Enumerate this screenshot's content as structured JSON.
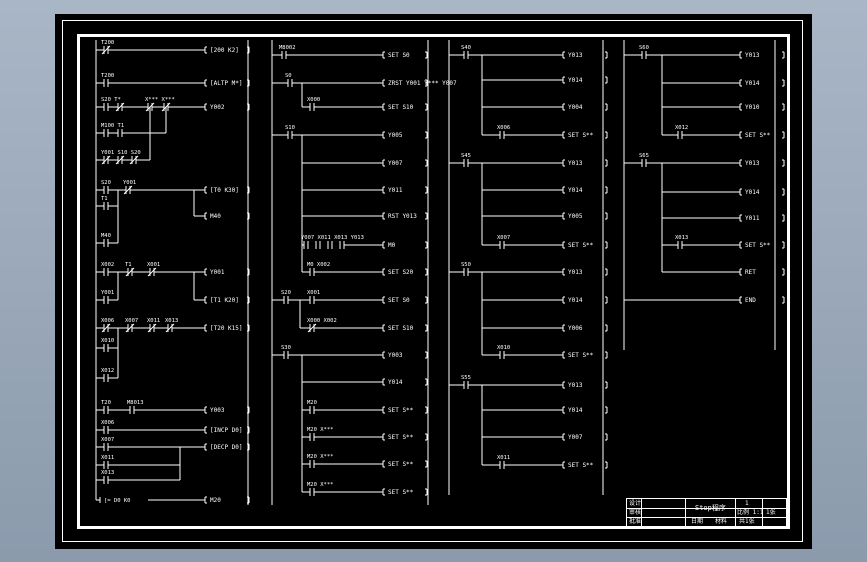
{
  "ladder": {
    "col1": {
      "contacts": [
        "T200",
        "T200",
        "S20 T*",
        "X*** X***",
        "M100 T1",
        "Y001 S10 S20",
        "S20",
        "Y001",
        "T1",
        "M40",
        "X002",
        "T1",
        "X001",
        "Y001",
        "X006",
        "X007",
        "X011",
        "X013",
        "X010",
        "X012",
        "T20",
        "M8013",
        "X006",
        "X007",
        "X011",
        "X013"
      ],
      "coils": [
        "[200 K2]",
        "[ALTP M*]",
        "Y002",
        "[T0 K30]",
        "M40",
        "Y001",
        "[T1 K20]",
        "[T20 K15]",
        "Y003",
        "[INCP D0]",
        "[DECP D0]",
        "M20"
      ],
      "compare": "[= D0 K0"
    },
    "col2": {
      "contacts": [
        "M8002",
        "S0",
        "X000",
        "S10",
        "Y007 X011 X013 Y013",
        "M0 X002",
        "S20",
        "X001",
        "X000 X002",
        "S30",
        "M20",
        "M20 X***",
        "M20 X***",
        "M20 X***"
      ],
      "coils": [
        "SET S0",
        "ZRST Y001 Y*** Y007",
        "SET S10",
        "Y005",
        "Y007",
        "Y011",
        "RST Y013",
        "M0",
        "SET S20",
        "SET S0",
        "SET S10",
        "Y003",
        "Y014",
        "SET S**",
        "SET S**",
        "SET S**",
        "SET S**"
      ]
    },
    "col3": {
      "contacts": [
        "S40",
        "X006",
        "S45",
        "X007",
        "S50",
        "X010",
        "S55",
        "X011"
      ],
      "coils": [
        "Y013",
        "Y014",
        "Y004",
        "SET S**",
        "Y013",
        "Y014",
        "Y005",
        "SET S**",
        "Y013",
        "Y014",
        "Y006",
        "SET S**",
        "Y013",
        "Y014",
        "Y007",
        "SET S**"
      ]
    },
    "col4": {
      "contacts": [
        "S60",
        "X012",
        "S65",
        "X013"
      ],
      "coils": [
        "Y013",
        "Y014",
        "Y010",
        "SET S**",
        "Y013",
        "Y014",
        "Y011",
        "SET S**",
        "RET",
        "END"
      ]
    }
  },
  "title_block": {
    "drawing_name": "Stop程序",
    "scale": "比例 1:1",
    "sheet": "1张",
    "designer": "设计",
    "checker": "审核",
    "approver": "批准",
    "date": "日期",
    "material": "材料",
    "number": "1",
    "total": "共1张"
  }
}
